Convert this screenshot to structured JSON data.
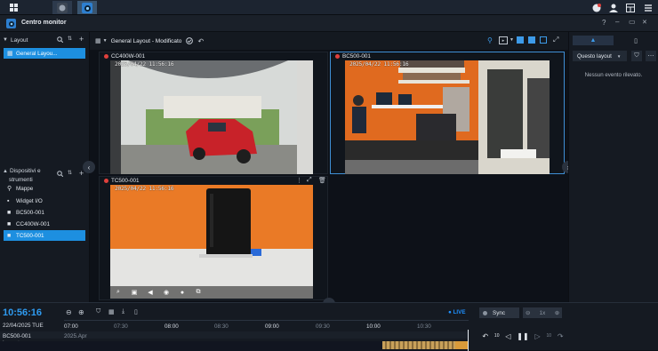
{
  "app": {
    "title": "Centro monitor"
  },
  "window_controls": {
    "help": "?",
    "minimize": "–",
    "restore": "▭",
    "close": "✕"
  },
  "left": {
    "layout_header": "Layout",
    "layout_items": [
      {
        "label": "General Layou..."
      }
    ],
    "devices_header_line1": "Dispositivi e",
    "devices_header_line2": "strumenti",
    "device_items": [
      {
        "label": "Mappe"
      },
      {
        "label": "Widget I/O"
      },
      {
        "label": "BC500-001"
      },
      {
        "label": "CC400W-001"
      },
      {
        "label": "TC500-001"
      }
    ]
  },
  "toolbar": {
    "layout_name": "General Layout - Modificato"
  },
  "cameras": [
    {
      "name": "CC400W-001",
      "timestamp": "2025/04/22 11:56:16"
    },
    {
      "name": "BC500-001",
      "timestamp": "2025/04/22 11:56:16"
    },
    {
      "name": "TC500-001",
      "timestamp": "2025/04/22 11:56:16"
    }
  ],
  "right": {
    "filter_label": "Questo layout",
    "empty_text": "Nessun evento rilevato."
  },
  "timeline": {
    "clock": "10:56:16",
    "date": "22/04/2025 TUE",
    "live_label": "LIVE",
    "sync_label": "Sync",
    "speed_label": "1x",
    "major_ticks": [
      "07:00",
      "08:00",
      "09:00",
      "10:00"
    ],
    "minor_ticks": [
      "07:30",
      "08:30",
      "09:30",
      "10:30"
    ],
    "track_name": "BC500-001",
    "track_date": "2025.Apr",
    "track_type": "Layout",
    "skip_back": "10",
    "skip_fwd": "10"
  },
  "colors": {
    "accent": "#1d8fe0",
    "rec_dot": "#e0403c",
    "live": "#1e90ff",
    "recording": "#c9a15a"
  }
}
